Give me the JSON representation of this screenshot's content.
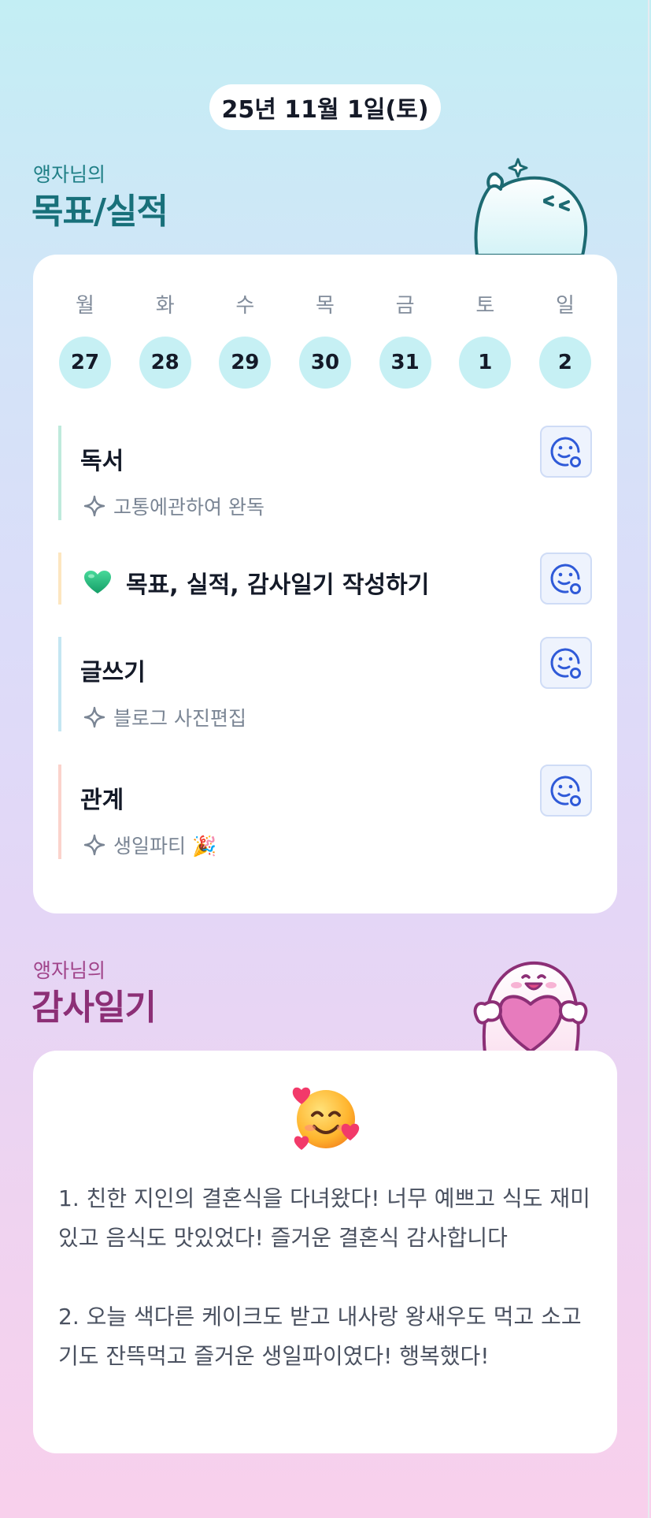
{
  "date": "25년 11월 1일(토)",
  "goals_section": {
    "owner": "앵자님의",
    "title": "목표/실적"
  },
  "week": [
    {
      "day": "월",
      "num": "27"
    },
    {
      "day": "화",
      "num": "28"
    },
    {
      "day": "수",
      "num": "29"
    },
    {
      "day": "목",
      "num": "30"
    },
    {
      "day": "금",
      "num": "31"
    },
    {
      "day": "토",
      "num": "1"
    },
    {
      "day": "일",
      "num": "2"
    }
  ],
  "goals": [
    {
      "title": "독서",
      "result": "고통에관하여 완독",
      "accent": "#bfeadc"
    },
    {
      "title": "목표, 실적, 감사일기 작성하기",
      "icon": "green-heart-icon",
      "accent": "#fde6c0"
    },
    {
      "title": "글쓰기",
      "result": "블로그 사진편집",
      "accent": "#c4e6f2"
    },
    {
      "title": "관계",
      "result": "생일파티 🎉",
      "accent": "#fbd3cc"
    }
  ],
  "diary_section": {
    "owner": "앵자님의",
    "title": "감사일기",
    "mood_icon": "smiling-face-with-hearts-icon",
    "entries": [
      "1. 친한 지인의 결혼식을 다녀왔다! 너무 예쁘고 식도 재미있고 음식도 맛있었다! 즐거운 결혼식 감사합니다",
      "2. 오늘 색다른 케이크도 받고 내사랑 왕새우도 먹고 소고기도 잔뜩먹고 즐거운 생일파이였다! 행복했다!"
    ]
  },
  "colors": {
    "teal_accent": "#1f7f86",
    "plum_accent": "#a0448a",
    "day_circle": "#c6f0f4",
    "mood_button": "#eef3fd"
  }
}
